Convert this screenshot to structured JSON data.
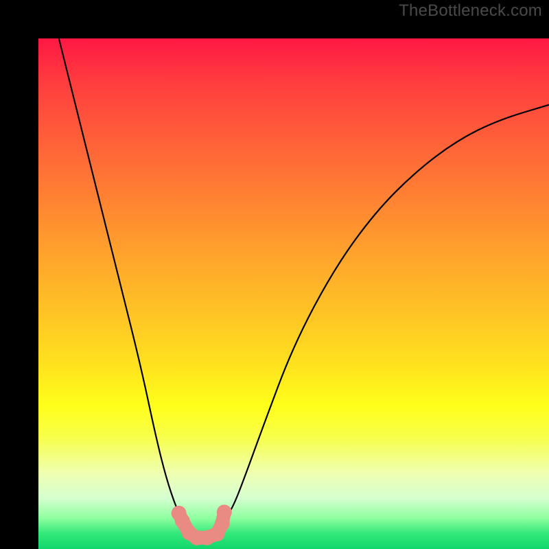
{
  "watermark": "TheBottleneck.com",
  "chart_data": {
    "type": "line",
    "title": "",
    "xlabel": "",
    "ylabel": "",
    "xlim": [
      0,
      100
    ],
    "ylim": [
      0,
      100
    ],
    "series": [
      {
        "name": "bottleneck-curve",
        "x": [
          4,
          8,
          12,
          16,
          20,
          23,
          25,
          27,
          29,
          30,
          32,
          34,
          36,
          38,
          40,
          44,
          50,
          58,
          66,
          74,
          82,
          90,
          100
        ],
        "values": [
          100,
          84,
          68,
          52,
          36,
          22,
          14,
          8,
          4,
          2,
          2,
          3,
          5,
          8,
          13,
          24,
          40,
          55,
          66,
          74,
          80,
          84,
          87
        ]
      },
      {
        "name": "optimal-band-markers",
        "x": [
          27.5,
          28.2,
          29.5,
          31.0,
          33.0,
          35.0,
          36.0,
          36.4
        ],
        "values": [
          7.0,
          5.5,
          3.2,
          2.2,
          2.2,
          3.0,
          5.0,
          7.2
        ]
      }
    ],
    "marker_color": "#e98b82",
    "curve_color": "#000000",
    "annotations": []
  }
}
